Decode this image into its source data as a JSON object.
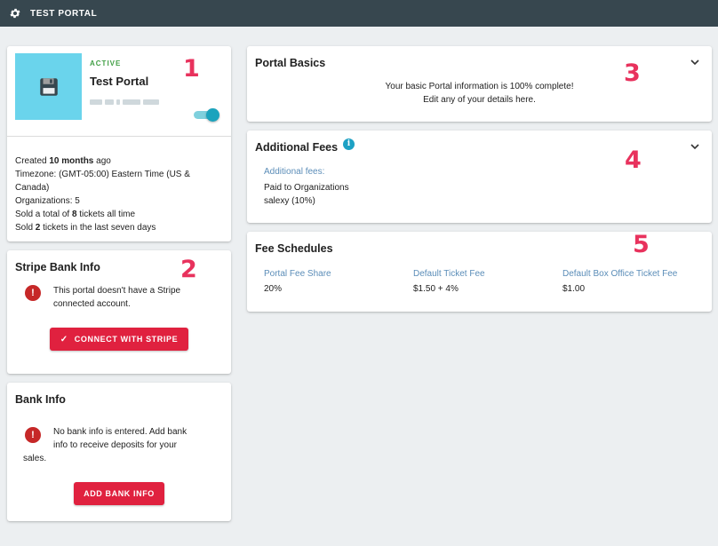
{
  "topbar": {
    "title": "TEST PORTAL",
    "icon": "gear-icon"
  },
  "portal": {
    "status": "ACTIVE",
    "name": "Test Portal",
    "created_prefix": "Created ",
    "created_value": "10 months",
    "created_suffix": " ago",
    "timezone": "Timezone: (GMT-05:00) Eastern Time (US & Canada)",
    "organizations": "Organizations: 5",
    "sold_total_prefix": "Sold a total of ",
    "sold_total_value": "8",
    "sold_total_suffix": " tickets all time",
    "sold_recent_prefix": "Sold ",
    "sold_recent_value": "2",
    "sold_recent_suffix": " tickets in the last seven days",
    "active_toggle": true
  },
  "stripe": {
    "title": "Stripe Bank Info",
    "message": "This portal doesn't have a Stripe connected account.",
    "button_label": "CONNECT WITH STRIPE"
  },
  "bank": {
    "title": "Bank Info",
    "message_line1": "No bank info is entered. Add bank",
    "message_line2": "info to receive deposits for your",
    "message_line3": "sales.",
    "button_label": "ADD BANK INFO"
  },
  "basics": {
    "title": "Portal Basics",
    "line1": "Your basic Portal information is 100% complete!",
    "line2": "Edit any of your details here."
  },
  "fees": {
    "title": "Additional Fees",
    "label": "Additional fees:",
    "line1": "Paid to Organizations",
    "line2": "salexy (10%)"
  },
  "schedules": {
    "title": "Fee Schedules",
    "columns": [
      {
        "label": "Portal Fee Share",
        "value": "20%"
      },
      {
        "label": "Default Ticket Fee",
        "value": "$1.50 + 4%"
      },
      {
        "label": "Default Box Office Ticket Fee",
        "value": "$1.00"
      }
    ]
  },
  "annotations": [
    "1",
    "2",
    "3",
    "4",
    "5"
  ],
  "colors": {
    "topbar": "#37474f",
    "accent_red": "#e0213f",
    "active_green": "#43a047",
    "toggle": "#1ba3bd",
    "annotation": "#e8325d",
    "label_blue": "#5b8db8"
  }
}
